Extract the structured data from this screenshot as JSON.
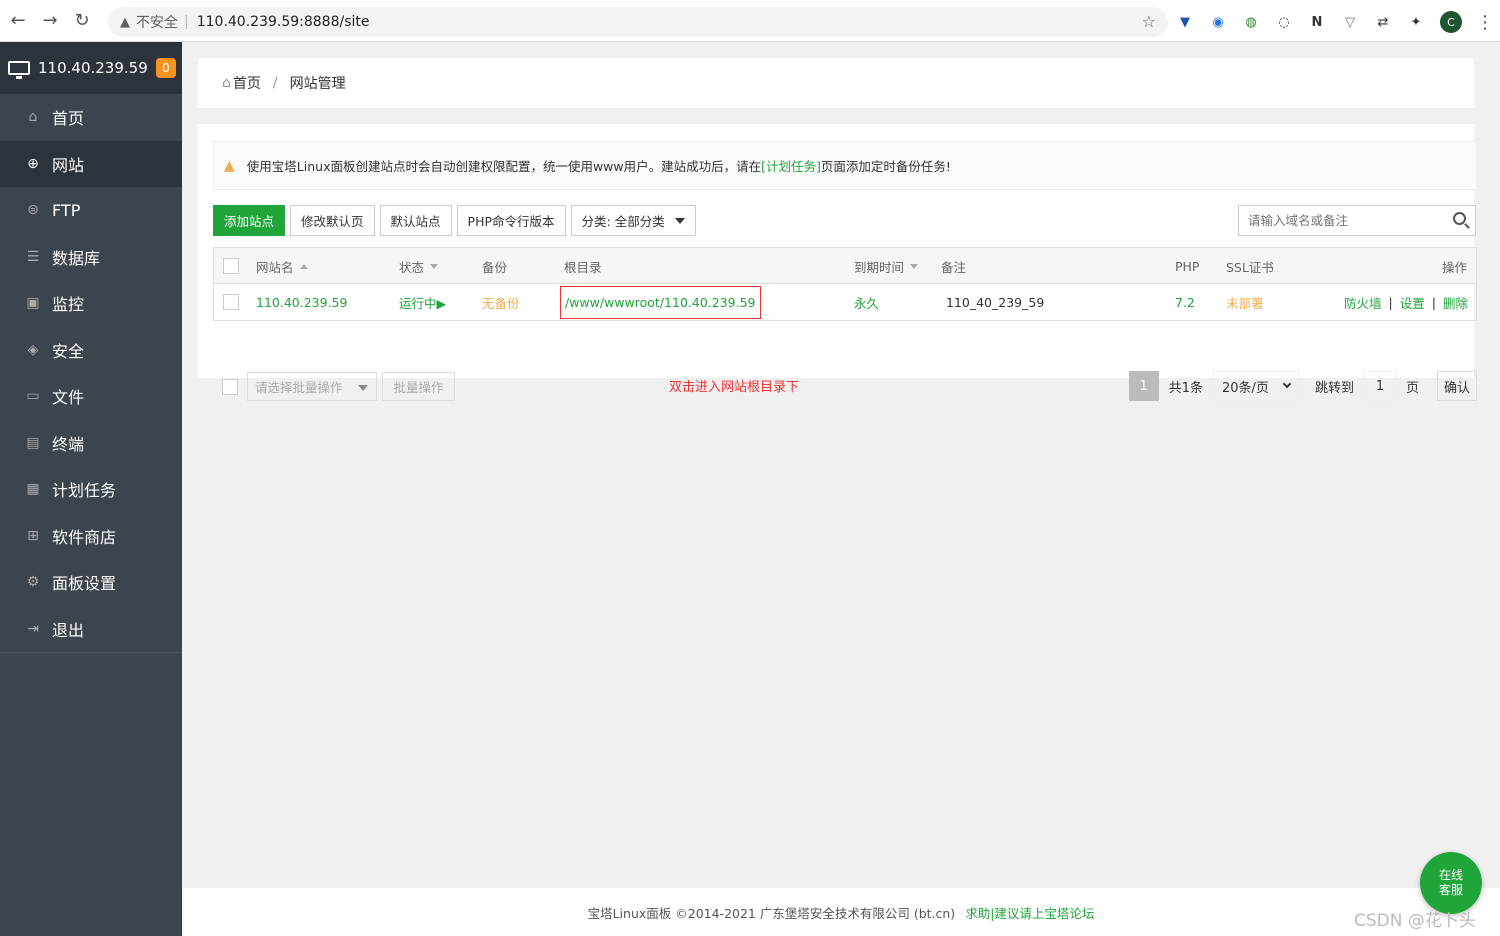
{
  "browser": {
    "insecure_label": "不安全",
    "url": "110.40.239.59:8888/site",
    "profile_initial": "C"
  },
  "sidebar": {
    "host": "110.40.239.59",
    "badge": "0",
    "items": [
      {
        "label": "首页",
        "icon": "home-icon"
      },
      {
        "label": "网站",
        "icon": "globe-icon"
      },
      {
        "label": "FTP",
        "icon": "ftp-icon"
      },
      {
        "label": "数据库",
        "icon": "database-icon"
      },
      {
        "label": "监控",
        "icon": "monitor-icon"
      },
      {
        "label": "安全",
        "icon": "shield-icon"
      },
      {
        "label": "文件",
        "icon": "folder-icon"
      },
      {
        "label": "终端",
        "icon": "terminal-icon"
      },
      {
        "label": "计划任务",
        "icon": "calendar-icon"
      },
      {
        "label": "软件商店",
        "icon": "grid-icon"
      },
      {
        "label": "面板设置",
        "icon": "gear-icon"
      },
      {
        "label": "退出",
        "icon": "logout-icon"
      }
    ]
  },
  "breadcrumb": {
    "home": "首页",
    "current": "网站管理"
  },
  "notice": {
    "text_before": "使用宝塔Linux面板创建站点时会自动创建权限配置，统一使用www用户。建站成功后，请在",
    "link": "[计划任务]",
    "text_after": "页面添加定时备份任务!"
  },
  "toolbar": {
    "add_site": "添加站点",
    "edit_default_page": "修改默认页",
    "default_site": "默认站点",
    "php_cli_version": "PHP命令行版本",
    "category": "分类: 全部分类"
  },
  "search": {
    "placeholder": "请输入域名或备注"
  },
  "table": {
    "headers": {
      "name": "网站名",
      "status": "状态",
      "backup": "备份",
      "root": "根目录",
      "expire": "到期时间",
      "note": "备注",
      "php": "PHP",
      "ssl": "SSL证书",
      "ops": "操作"
    },
    "rows": [
      {
        "name": "110.40.239.59",
        "status": "运行中▶",
        "backup": "无备份",
        "root": "/www/wwwroot/110.40.239.59",
        "expire": "永久",
        "note": "110_40_239_59",
        "php": "7.2",
        "ssl": "未部署",
        "op_firewall": "防火墙",
        "op_settings": "设置",
        "op_delete": "删除"
      }
    ]
  },
  "batch": {
    "select_placeholder": "请选择批量操作",
    "button": "批量操作"
  },
  "annotation": "双击进入网站根目录下",
  "pager": {
    "current": "1",
    "total": "共1条",
    "per_page": "20条/页",
    "jump_label": "跳转到",
    "jump_value": "1",
    "page_unit": "页",
    "confirm": "确认"
  },
  "footer": {
    "copyright": "宝塔Linux面板 ©2014-2021 广东堡塔安全技术有限公司 (bt.cn)",
    "link": "求助|建议请上宝塔论坛"
  },
  "support_bubble": {
    "line1": "在线",
    "line2": "客服"
  },
  "watermark": "CSDN @花卜头"
}
